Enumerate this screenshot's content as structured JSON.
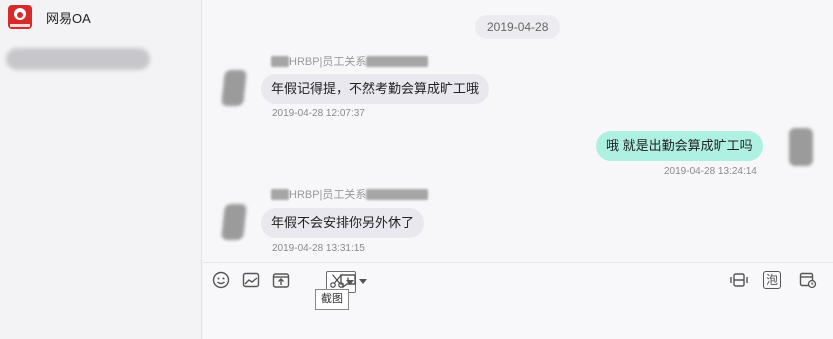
{
  "sidebar": {
    "contact_name": "网易OA"
  },
  "chat": {
    "date_separator": "2019-04-28",
    "messages": [
      {
        "sender_label": "HRBP|员工关系",
        "text": "年假记得提，不然考勤会算成旷工哦",
        "timestamp": "2019-04-28 12:07:37",
        "mine": false
      },
      {
        "sender_label": "",
        "text": "哦 就是出勤会算成旷工吗",
        "timestamp": "2019-04-28 13:24:14",
        "mine": true
      },
      {
        "sender_label": "HRBP|员工关系",
        "text": "年假不会安排你另外休了",
        "timestamp": "2019-04-28 13:31:15",
        "mine": false
      }
    ]
  },
  "toolbar": {
    "left_tools": [
      "emoji-icon",
      "image-icon",
      "upload-file-icon",
      "screenshot-scissors-icon",
      "quick-reply-icon"
    ],
    "right_tools": [
      "history-icon",
      "bubble-icon",
      "schedule-icon"
    ],
    "right_tool_glyph": "泡",
    "tooltip": "截图"
  }
}
